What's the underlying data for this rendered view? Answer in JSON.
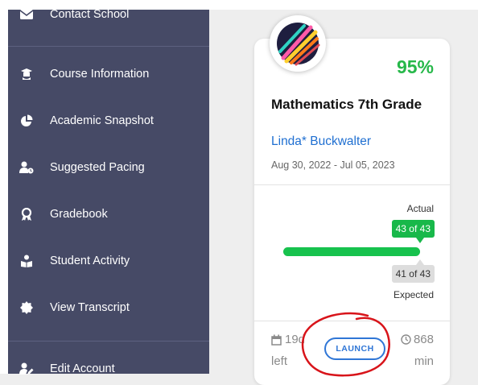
{
  "sidebar": {
    "items": [
      {
        "label": "Contact School",
        "icon": "envelope-icon"
      },
      {
        "label": "Course Information",
        "icon": "graduation-cap-icon"
      },
      {
        "label": "Academic Snapshot",
        "icon": "pie-chart-icon"
      },
      {
        "label": "Suggested Pacing",
        "icon": "user-clock-icon"
      },
      {
        "label": "Gradebook",
        "icon": "award-icon"
      },
      {
        "label": "Student Activity",
        "icon": "user-book-icon"
      },
      {
        "label": "View Transcript",
        "icon": "certificate-icon"
      },
      {
        "label": "Edit Account",
        "icon": "user-edit-icon"
      }
    ]
  },
  "course_card": {
    "logo": "course-logo-icon",
    "grade": "95%",
    "title": "Mathematics 7th Grade",
    "teacher": "Linda* Buckwalter",
    "dates": "Aug 30, 2022 - Jul 05, 2023",
    "progress": {
      "actual_label": "Actual",
      "actual_value": "43 of 43",
      "actual_fraction": 1.0,
      "expected_value": "41 of 43",
      "expected_label": "Expected"
    },
    "days_remaining": "19d",
    "days_unit": "left",
    "minutes": "868",
    "minutes_unit": "min",
    "launch_label": "LAUNCH"
  },
  "colors": {
    "sidebar_bg": "#464a66",
    "grade_green": "#27b84a",
    "link_blue": "#1f6fd1",
    "progress_green": "#17c24d",
    "annotation_red": "#d8141a"
  }
}
